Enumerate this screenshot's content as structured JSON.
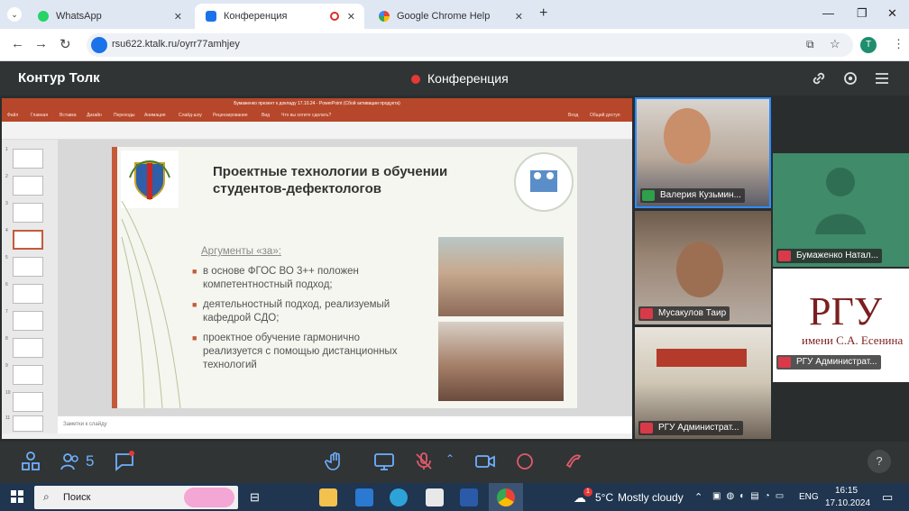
{
  "browser": {
    "tabs": [
      {
        "label": "WhatsApp",
        "active": false
      },
      {
        "label": "Конференция",
        "active": true
      },
      {
        "label": "Google Chrome Help",
        "active": false
      }
    ],
    "new_tab": "+",
    "url": "rsu622.ktalk.ru/oyrr77amhjey",
    "profile_initial": "T"
  },
  "app": {
    "brand": "Контур Толк",
    "title": "Конференция"
  },
  "presentation": {
    "window_title": "Бумаженко презент к докладу 17.10.24 - PowerPoint (Сбой активации продукта)",
    "menu": [
      "Файл",
      "Главная",
      "Вставка",
      "Дизайн",
      "Переходы",
      "Анимация",
      "Слайд-шоу",
      "Рецензирование",
      "Вид",
      "Что вы хотите сделать?"
    ],
    "menu_right": [
      "Вход",
      "Общий доступ"
    ],
    "thumb_numbers": [
      "1",
      "2",
      "3",
      "4",
      "5",
      "6",
      "7",
      "8",
      "9",
      "10",
      "11"
    ],
    "slide": {
      "heading": "Проектные технологии в обучении студентов-дефектологов",
      "arguments_label": "Аргументы «за»:",
      "bullets": [
        "в основе ФГОС ВО 3++ положен компетентностный подход;",
        "деятельностный подход, реализуемый кафедрой СДО;",
        "проектное обучение гармонично реализуется с помощью дистанционных технологий"
      ],
      "accent_color": "#c55a3b"
    },
    "notes": "Заметки к слайду"
  },
  "participants": [
    {
      "name": "Валерия Кузьмин...",
      "mic": "on"
    },
    {
      "name": "Бумаженко Натал...",
      "mic": "off"
    },
    {
      "name": "Мусакулов Таир",
      "mic": "off"
    },
    {
      "name": "РГУ Администрат...",
      "mic": "off",
      "logo_text": "РГУ",
      "logo_sub": "имени С.А. Есенина"
    },
    {
      "name": "РГУ Администрат...",
      "mic": "off"
    }
  ],
  "controls": {
    "participants_count": "5",
    "help": "?"
  },
  "taskbar": {
    "search_label": "Поиск",
    "weather_temp": "5°C",
    "weather_text": "Mostly cloudy",
    "weather_badge": "1",
    "lang": "ENG",
    "time": "16:15",
    "date": "17.10.2024"
  }
}
